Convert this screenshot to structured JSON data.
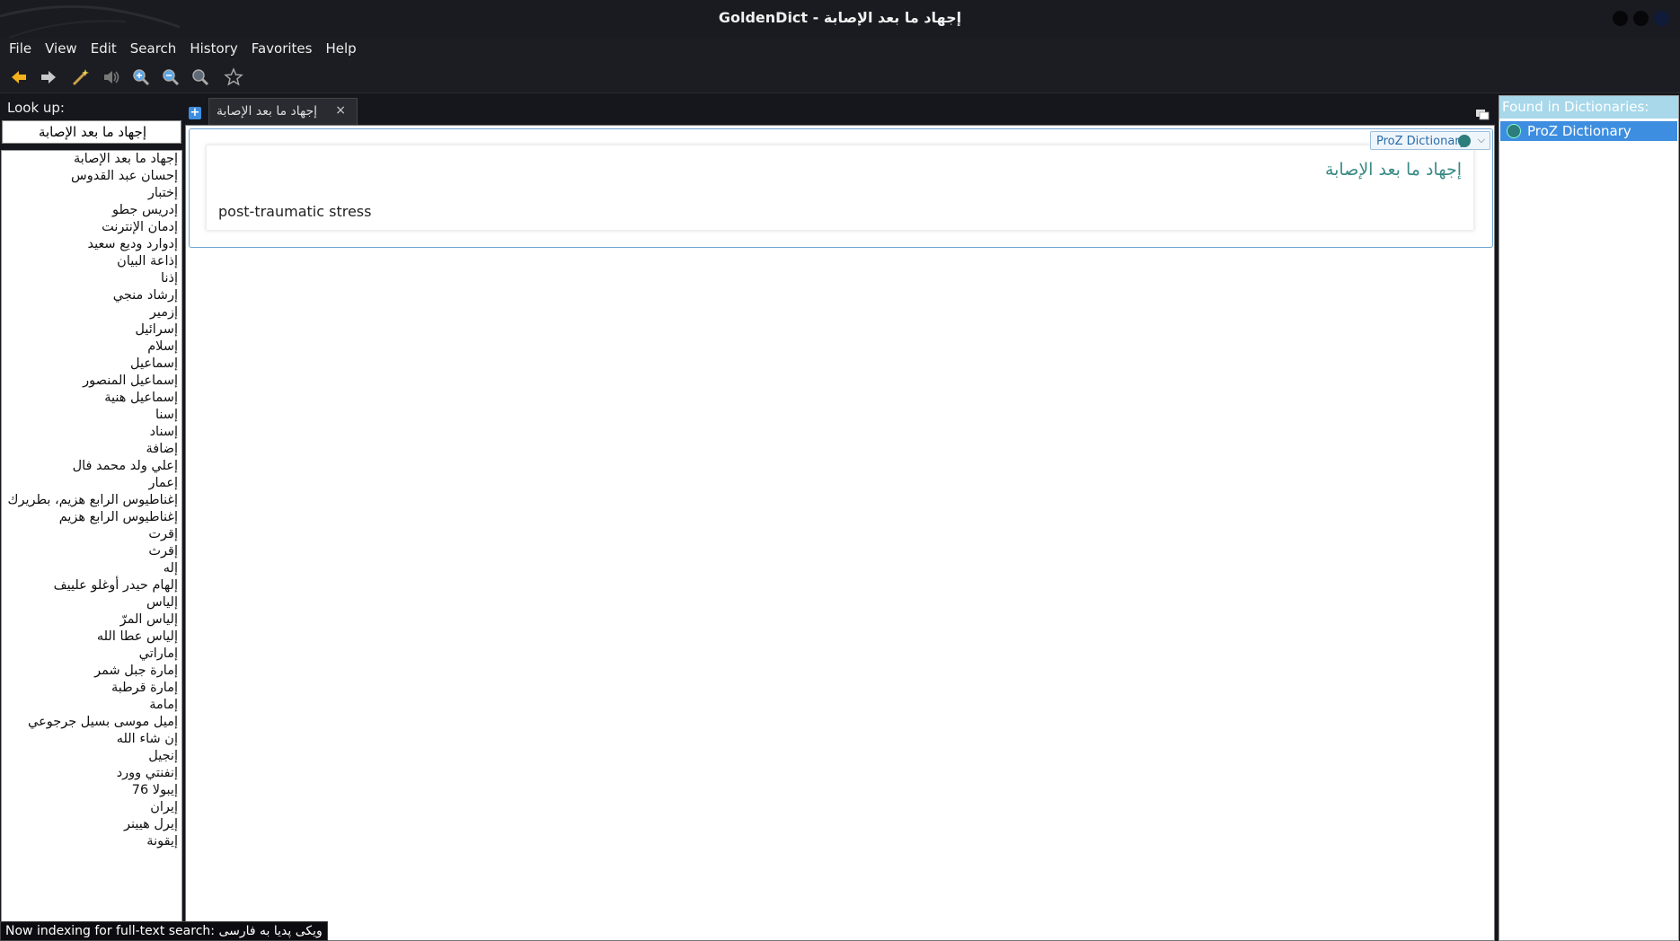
{
  "window": {
    "title": "GoldenDict - إجهاد ما بعد الإصابة"
  },
  "menubar": {
    "items": [
      "File",
      "View",
      "Edit",
      "Search",
      "History",
      "Favorites",
      "Help"
    ]
  },
  "toolbar": {
    "icons": [
      "back-arrow-icon",
      "forward-arrow-icon",
      "scan-popup-wand-icon",
      "pronounce-speaker-icon",
      "zoom-in-icon",
      "zoom-out-icon",
      "zoom-reset-icon",
      "add-to-favorites-star-icon"
    ]
  },
  "lookup": {
    "label": "Look up:",
    "value": "إجهاد ما بعد الإصابة"
  },
  "wordlist": {
    "items": [
      "إجهاد ما بعد الإصابة",
      "إحسان عبد القدوس",
      "إختبار",
      "إدريس جطو",
      "إدمان الإنترنت",
      "إدوارد وديع سعيد",
      "إذاعة البيان",
      "إذنا",
      "إرشاد منجي",
      "إزمير",
      "إسرائيل",
      "إسلام",
      "إسماعيل",
      "إسماعيل المنصور",
      "إسماعيل هنية",
      "إسنا",
      "إسناد",
      "إضافة",
      "إعلي ولد محمد فال",
      "إعمار",
      "إغناطيوس الرابع هزيم، بطريرك",
      "إغناطيوس الرابع هزيم",
      "إقرت",
      "إقرث",
      "إله",
      "إلهام حيدر أوغلو علييف",
      "إلياس",
      "إلياس المرّ",
      "إلياس عطا الله",
      "إماراتي",
      "إمارة جبل شمر",
      "إمارة قرطبة",
      "إمامة",
      "إميل موسى بسيل جرجوعي",
      "إن شاء الله",
      "إنجيل",
      "إنفنتي وورد",
      "إيبولا 76",
      "إيران",
      "إيرل هيينر",
      "إيقونة"
    ]
  },
  "tab": {
    "label": "إجهاد ما بعد الإصابة",
    "close": "×",
    "new_tab": "+"
  },
  "article": {
    "dictionary_name": "ProZ Dictionary",
    "headword": "إجهاد ما بعد الإصابة",
    "definition": "post-traumatic stress"
  },
  "found_in": {
    "header": "Found in Dictionaries:",
    "items": [
      "ProZ Dictionary"
    ]
  },
  "status": {
    "text": "Now indexing for full-text search: ویکی پدیا به فارسی"
  }
}
